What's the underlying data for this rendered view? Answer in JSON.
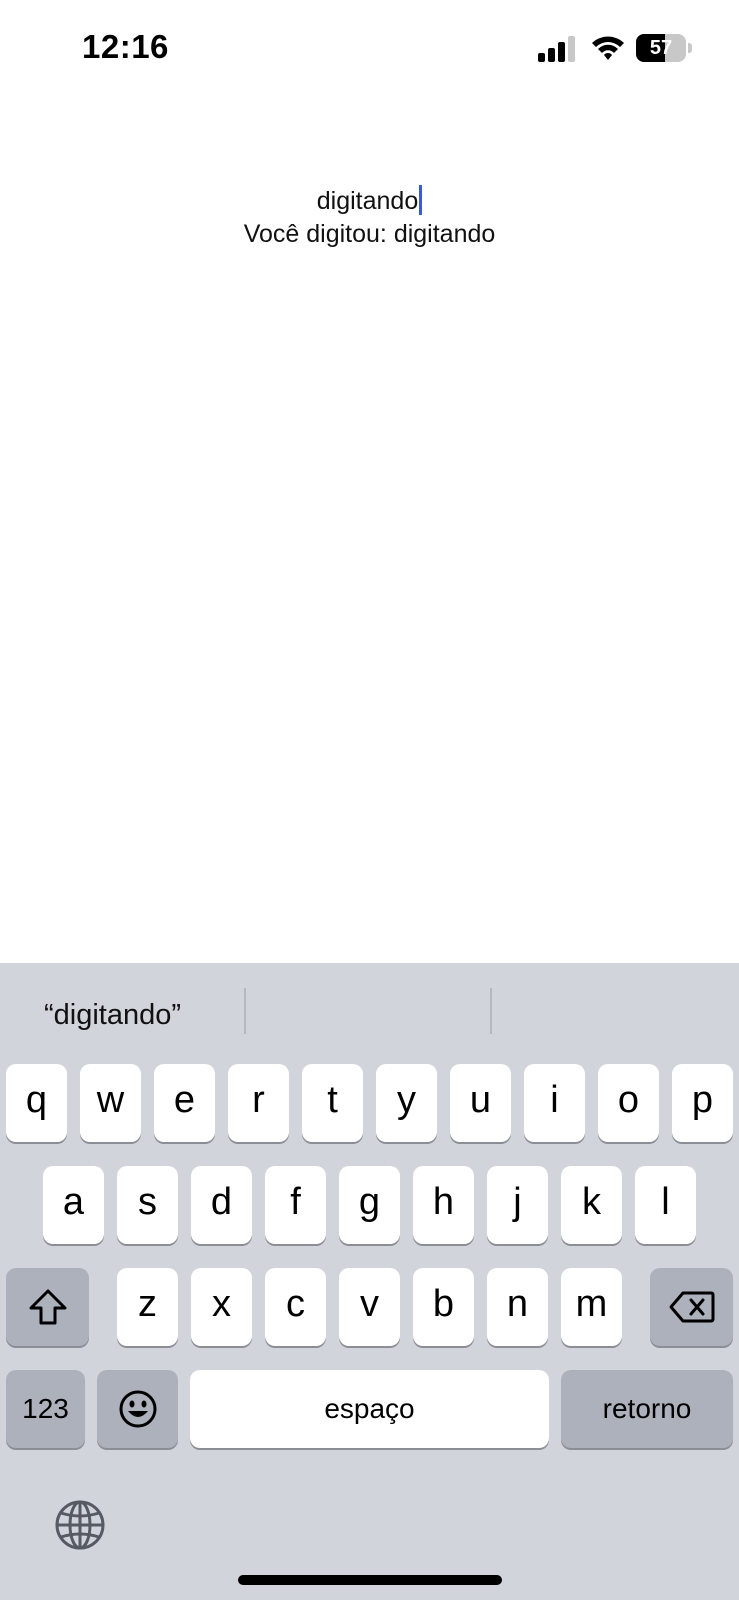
{
  "status_bar": {
    "time": "12:16",
    "battery_level": "57",
    "battery_fraction": 0.57,
    "signal_icon": "cellular-signal-icon",
    "wifi_icon": "wifi-icon",
    "battery_icon": "battery-icon"
  },
  "app": {
    "input_value": "digitando",
    "echo_text": "Você digitou: digitando"
  },
  "keyboard": {
    "suggestions": [
      "“digitando”",
      "",
      ""
    ],
    "row1": [
      "q",
      "w",
      "e",
      "r",
      "t",
      "y",
      "u",
      "i",
      "o",
      "p"
    ],
    "row2": [
      "a",
      "s",
      "d",
      "f",
      "g",
      "h",
      "j",
      "k",
      "l"
    ],
    "row3": [
      "z",
      "x",
      "c",
      "v",
      "b",
      "n",
      "m"
    ],
    "shift_icon": "shift-icon",
    "backspace_icon": "backspace-icon",
    "numbers_label": "123",
    "emoji_icon": "emoji-icon",
    "space_label": "espaço",
    "return_label": "retorno",
    "globe_icon": "globe-icon"
  },
  "colors": {
    "keyboard_bg": "#d1d4db",
    "key_bg": "#ffffff",
    "special_key_bg": "#acb1bb",
    "caret": "#3b5bd6"
  }
}
